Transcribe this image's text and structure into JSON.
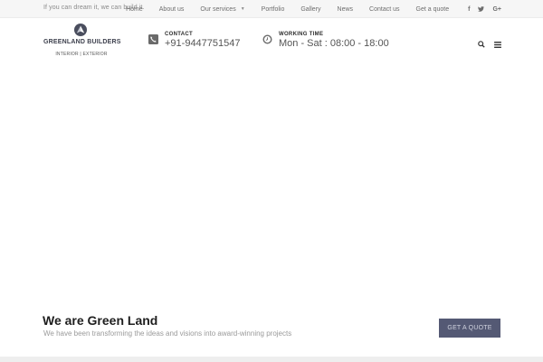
{
  "topbar": {
    "tagline": "If you can dream it, we can build it.",
    "nav": [
      {
        "label": "Home"
      },
      {
        "label": "About us"
      },
      {
        "label": "Our services"
      },
      {
        "label": "Portfolio"
      },
      {
        "label": "Gallery"
      },
      {
        "label": "News"
      },
      {
        "label": "Contact us"
      },
      {
        "label": "Get a quote"
      }
    ],
    "social": {
      "facebook": "f",
      "google_plus": "G+"
    }
  },
  "header": {
    "logo_name": "GREENLAND BUILDERS",
    "logo_sub": "INTERIOR | EXTERIOR",
    "contact_label": "CONTACT",
    "contact_value": "+91-9447751547",
    "hours_label": "WORKING TIME",
    "hours_value": "Mon - Sat : 08:00 - 18:00"
  },
  "cta": {
    "title": "We are Green Land",
    "subtitle": "We have been transforming the ideas and visions into award-winning projects",
    "button": "GET A QUOTE"
  },
  "colors": {
    "accent": "#545974",
    "topbar_bg": "#f6f6f6",
    "text_dark": "#1e1e1e"
  },
  "icons": [
    "phone-icon",
    "clock-icon",
    "search-icon",
    "menu-icon",
    "facebook-icon",
    "twitter-icon",
    "google-plus-icon",
    "chevron-down-icon",
    "logo-mark-icon"
  ]
}
